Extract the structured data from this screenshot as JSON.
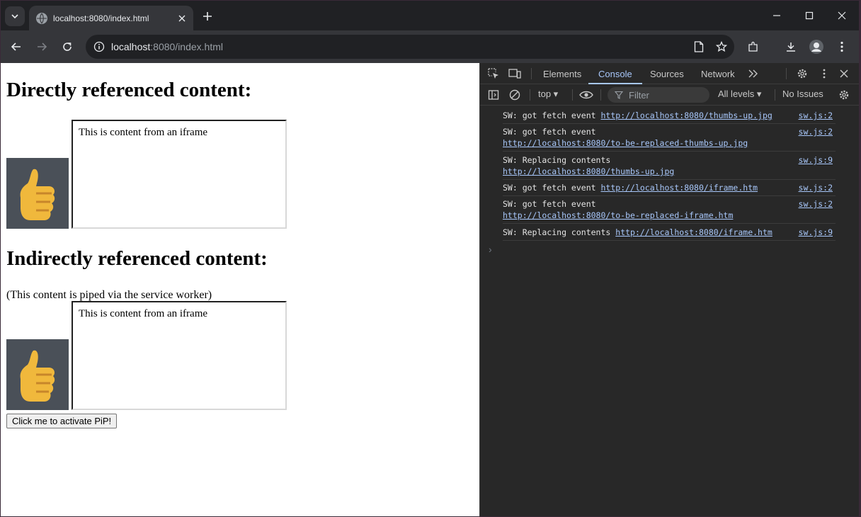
{
  "browser": {
    "tab_title": "localhost:8080/index.html",
    "url_host": "localhost",
    "url_rest": ":8080/index.html"
  },
  "page": {
    "heading_direct": "Directly referenced content:",
    "heading_indirect": "Indirectly referenced content:",
    "indirect_note": "(This content is piped via the service worker)",
    "iframe_text_1": "This is content from an iframe",
    "iframe_text_2": "This is content from an iframe",
    "pip_button": "Click me to activate PiP!"
  },
  "devtools": {
    "tabs": [
      "Elements",
      "Console",
      "Sources",
      "Network"
    ],
    "context": "top ▾",
    "filter_placeholder": "Filter",
    "levels": "All levels ▾",
    "issues": "No Issues",
    "messages": [
      {
        "text": "SW: got fetch event",
        "link": "http://localhost:8080/thumbs-up.jpg",
        "source": "sw.js:2"
      },
      {
        "text": "SW: got fetch event",
        "link": "http://localhost:8080/to-be-replaced-thumbs-up.jpg",
        "source": "sw.js:2"
      },
      {
        "text": "SW: Replacing contents",
        "link": "http://localhost:8080/thumbs-up.jpg",
        "source": "sw.js:9"
      },
      {
        "text": "SW: got fetch event",
        "link": "http://localhost:8080/iframe.htm",
        "source": "sw.js:2"
      },
      {
        "text": "SW: got fetch event",
        "link": "http://localhost:8080/to-be-replaced-iframe.htm",
        "source": "sw.js:2"
      },
      {
        "text": "SW: Replacing contents",
        "link": "http://localhost:8080/iframe.htm",
        "source": "sw.js:9"
      }
    ],
    "prompt": "›"
  }
}
